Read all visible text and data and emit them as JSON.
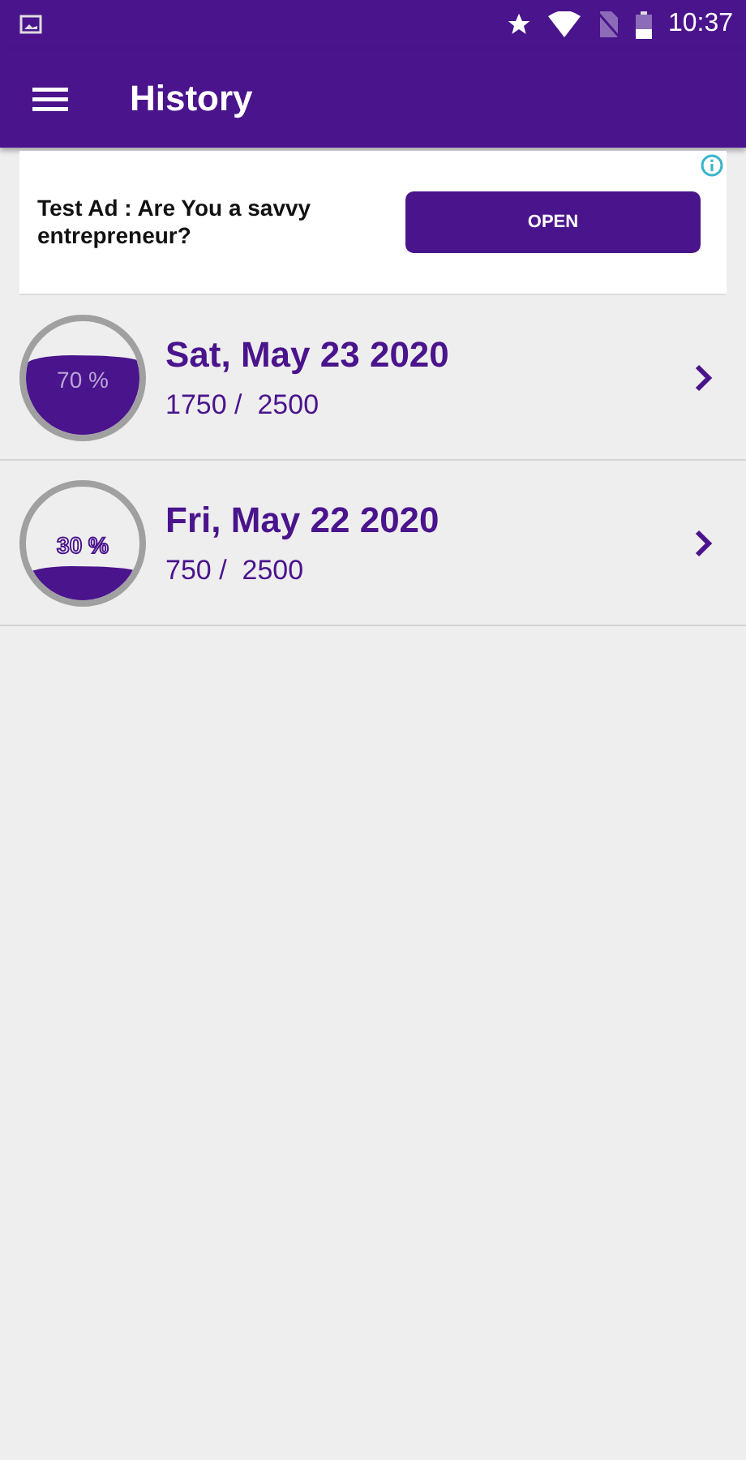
{
  "status_bar": {
    "time": "10:37"
  },
  "app_bar": {
    "title": "History"
  },
  "ad": {
    "text": "Test Ad : Are You a savvy entrepreneur?",
    "button": "OPEN"
  },
  "entries": [
    {
      "date": "Sat, May 23 2020",
      "amount": "1750 /  2500",
      "percent": "70 %",
      "kind": "high"
    },
    {
      "date": "Fri, May 22 2020",
      "amount": "750 /  2500",
      "percent": "30 %",
      "kind": "low"
    }
  ]
}
